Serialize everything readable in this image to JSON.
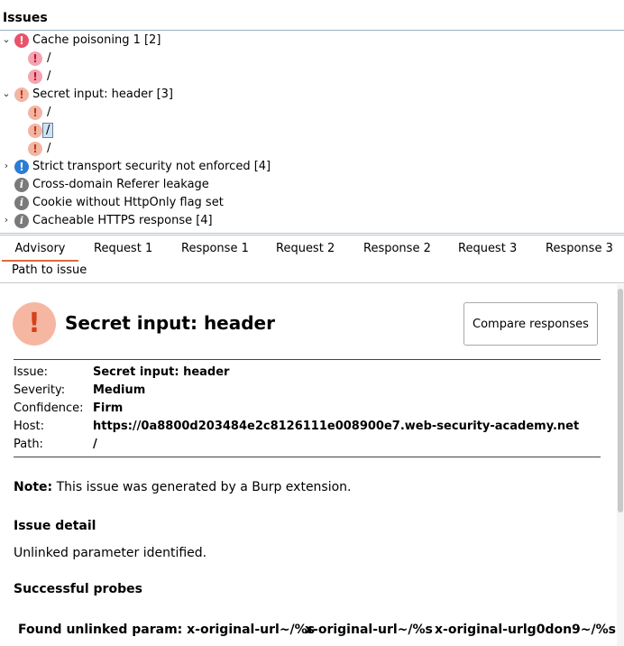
{
  "issues": {
    "title": "Issues",
    "items": [
      {
        "label": "Cache poisoning 1 [2]",
        "expanded": true,
        "severity": "high",
        "children": [
          "/",
          "/"
        ]
      },
      {
        "label": "Secret input: header [3]",
        "expanded": true,
        "severity": "medium",
        "children": [
          "/",
          "/",
          "/"
        ],
        "selected_child": 1
      },
      {
        "label": "Strict transport security not enforced [4]",
        "expanded": false,
        "severity": "info"
      },
      {
        "label": "Cross-domain Referer leakage",
        "severity": "none"
      },
      {
        "label": "Cookie without HttpOnly flag set",
        "severity": "none"
      },
      {
        "label": "Cacheable HTTPS response [4]",
        "expanded": false,
        "severity": "none"
      }
    ]
  },
  "tabs": [
    "Advisory",
    "Request 1",
    "Response 1",
    "Request 2",
    "Response 2",
    "Request 3",
    "Response 3",
    "Path to issue"
  ],
  "active_tab": "Advisory",
  "advisory": {
    "title": "Secret input: header",
    "compare_button": "Compare responses",
    "fields": [
      {
        "key": "Issue:",
        "value": "Secret input: header"
      },
      {
        "key": "Severity:",
        "value": "Medium"
      },
      {
        "key": "Confidence:",
        "value": "Firm"
      },
      {
        "key": "Host:",
        "value": "https://0a8800d203484e2c8126111e008900e7.web-security-academy.net"
      },
      {
        "key": "Path:",
        "value": "/"
      }
    ],
    "note_label": "Note:",
    "note_text": " This issue was generated by a Burp extension.",
    "detail_heading": "Issue detail",
    "detail_text": "Unlinked parameter identified.",
    "probes_heading": "Successful probes",
    "probes": [
      "Found unlinked param: x-original-url~/%s",
      "x-original-url~/%s",
      "x-original-urlg0don9~/%s"
    ]
  },
  "colors": {
    "high": "#e8536a",
    "medium": "#f2b5a3",
    "info": "#2b7cd3",
    "accent_tab": "#e06a3c"
  }
}
